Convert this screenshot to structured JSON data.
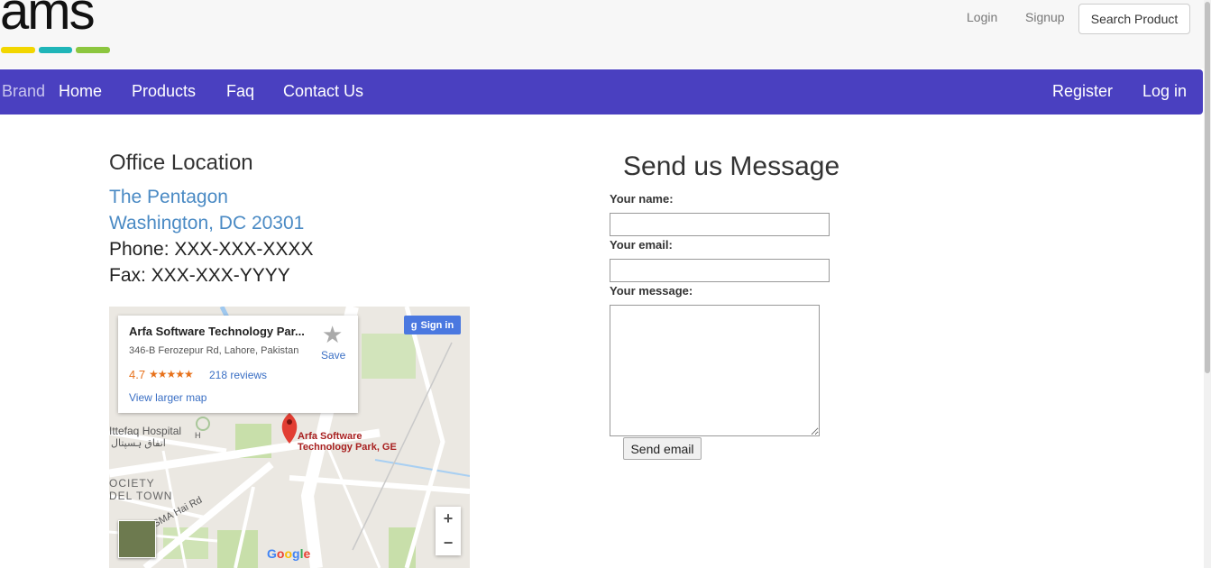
{
  "header": {
    "logo_text": "ams",
    "logo_colors": [
      "#f2d600",
      "#1fb5b8",
      "#8cc63f"
    ],
    "login_label": "Login",
    "signup_label": "Signup",
    "search_product_label": "Search Product"
  },
  "nav": {
    "brand": "Brand",
    "items": [
      "Home",
      "Products",
      "Faq",
      "Contact Us"
    ],
    "right_items": [
      "Register",
      "Log in"
    ],
    "background_color": "#4a40c0"
  },
  "office": {
    "title": "Office Location",
    "address_line1": "The Pentagon",
    "address_line2": "Washington, DC 20301",
    "phone": "Phone: XXX-XXX-XXXX",
    "fax": "Fax: XXX-XXX-YYYY"
  },
  "map": {
    "place_name": "Arfa Software Technology Par...",
    "address": "346-B Ferozepur Rd, Lahore, Pakistan",
    "rating": "4.7",
    "stars": "★★★★★",
    "reviews": "218 reviews",
    "larger_map": "View larger map",
    "save_label": "Save",
    "signin_label": "Sign in",
    "pin_label_line1": "Arfa Software",
    "pin_label_line2": "Technology Park, GE",
    "hospital_label": "Ittefaq Hospital",
    "hospital_urdu": "اتفاق ہسپتال",
    "society_label_1": "OCIETY",
    "society_label_2": "DEL TOWN",
    "road_label": "SMA Hai Rd",
    "zoom_in": "+",
    "zoom_out": "−",
    "google_logo": "Google",
    "marker_h": "H"
  },
  "form": {
    "title": "Send us Message",
    "name_label": "Your name:",
    "email_label": "Your email:",
    "message_label": "Your message:",
    "name_value": "",
    "email_value": "",
    "message_value": "",
    "send_label": "Send email"
  }
}
